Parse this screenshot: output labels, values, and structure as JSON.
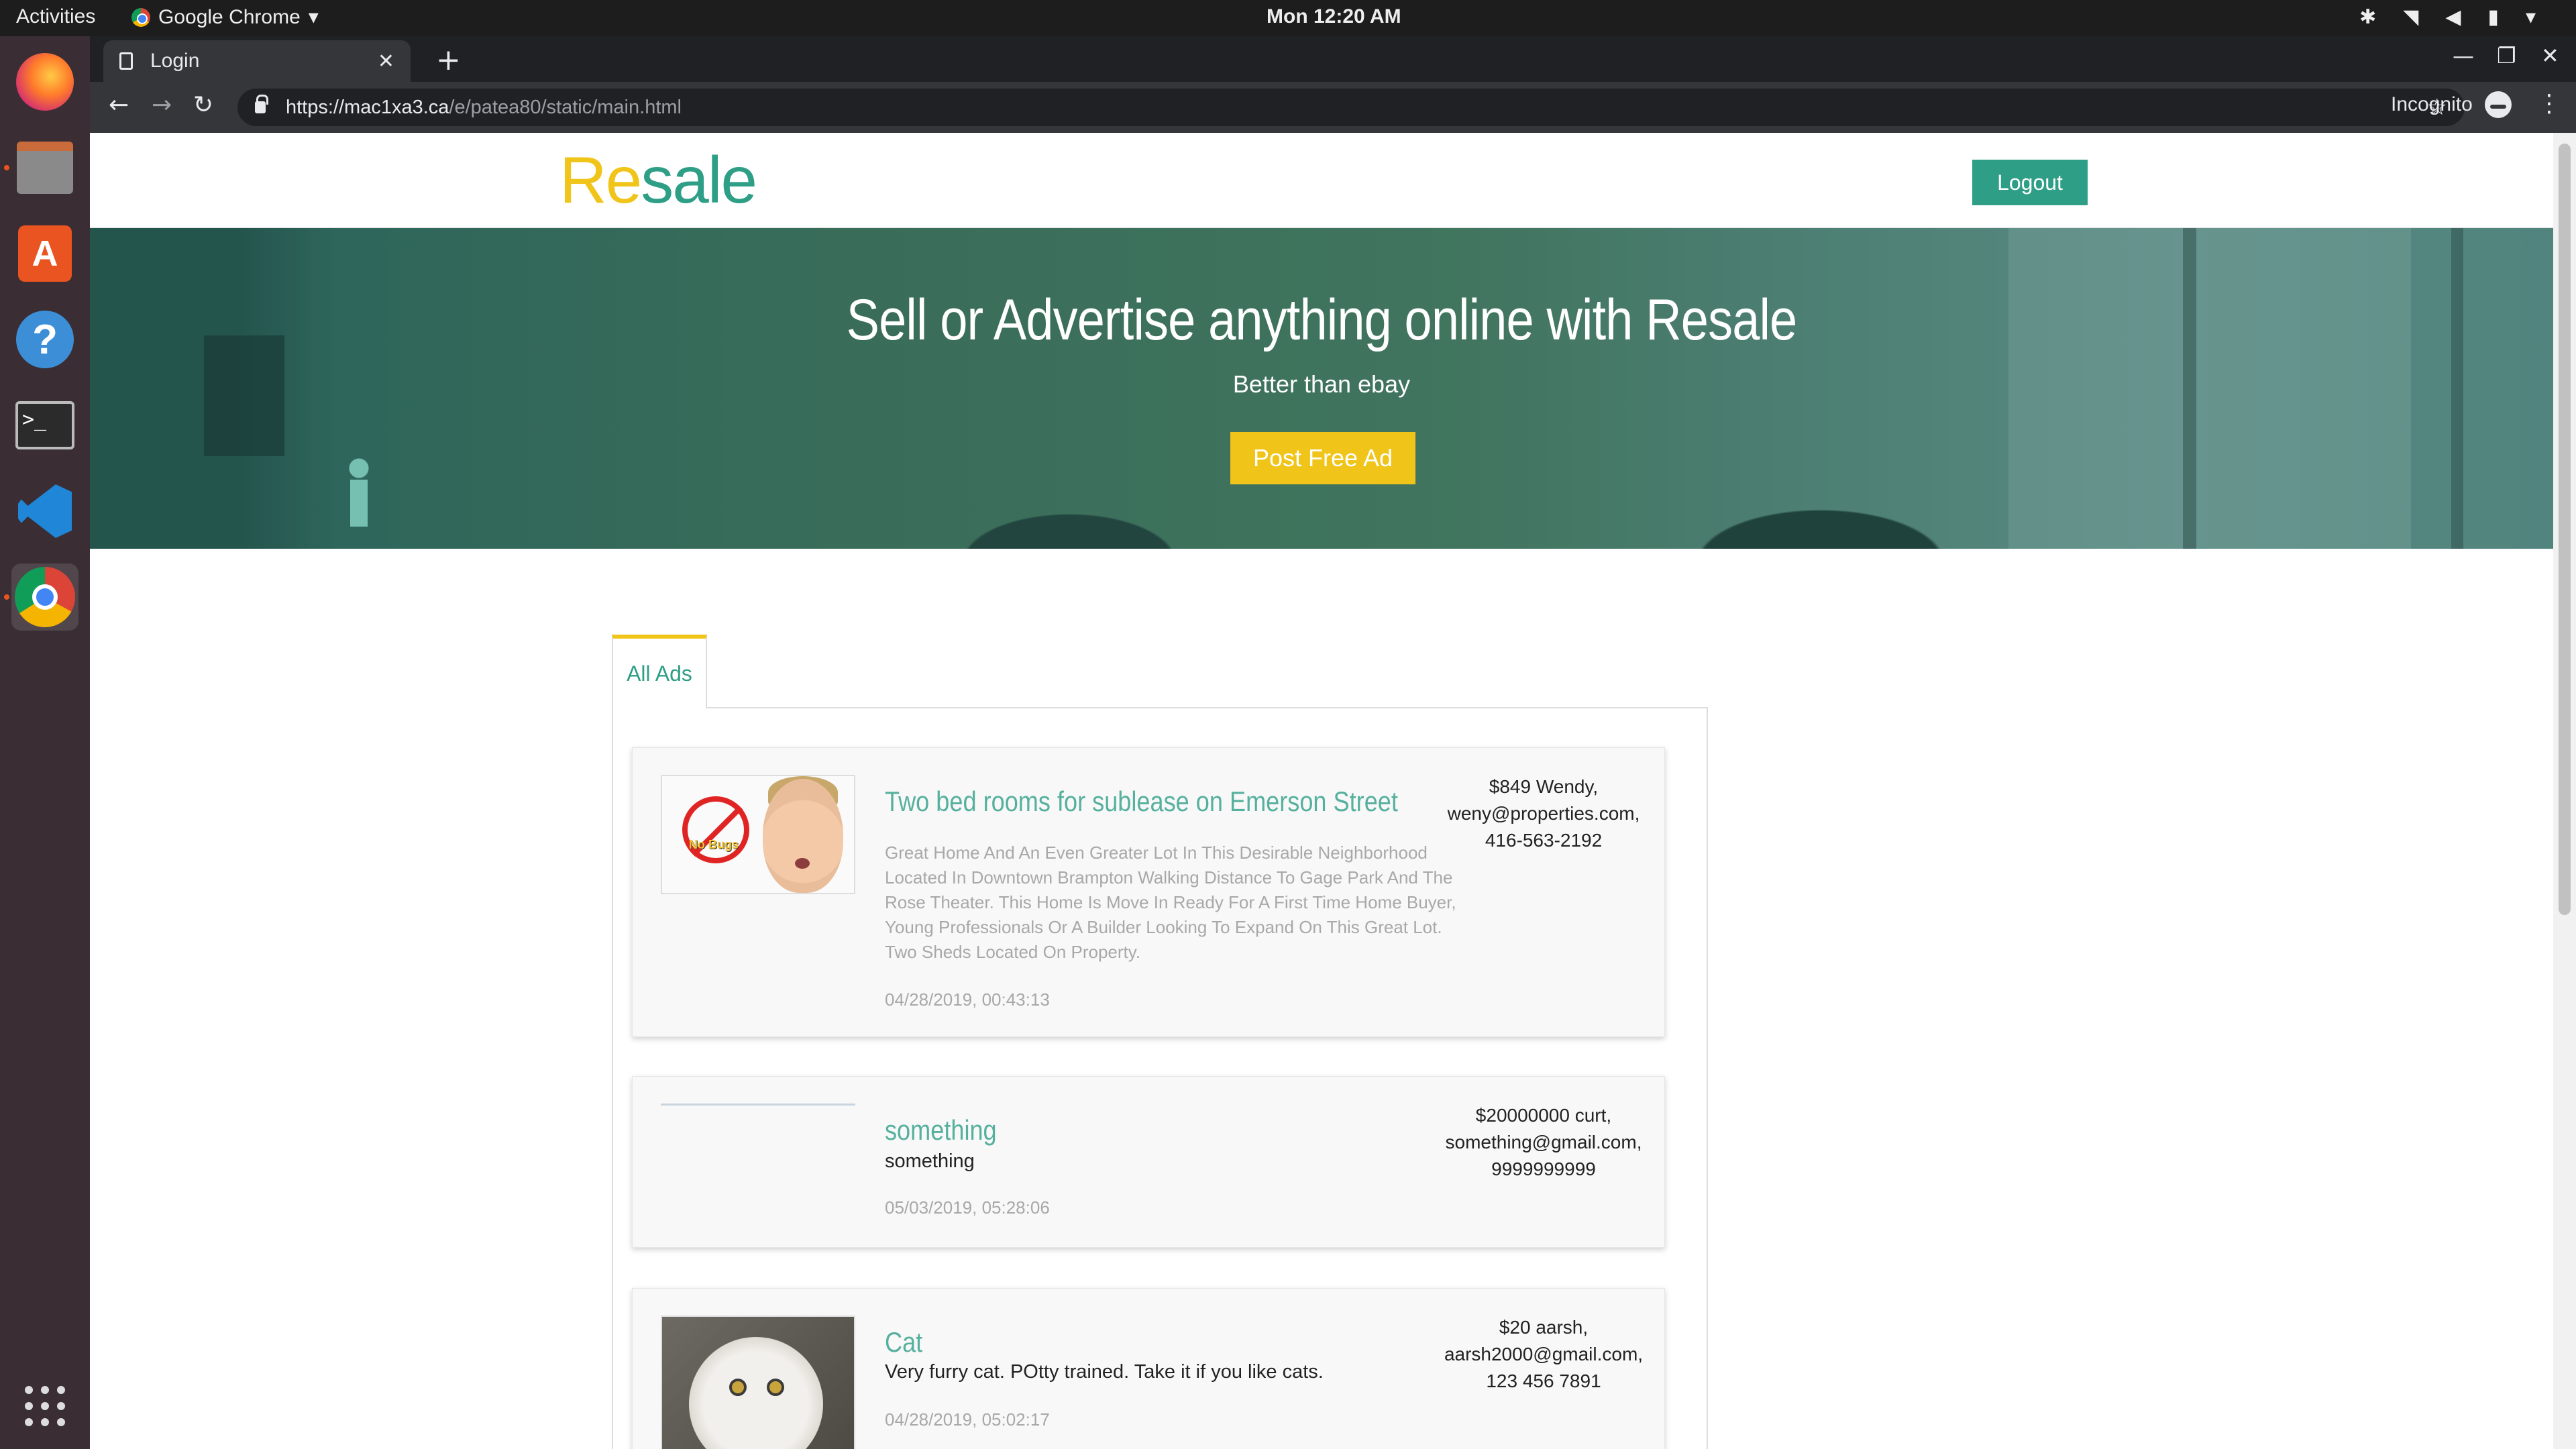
{
  "system": {
    "activities": "Activities",
    "app_name": "Google Chrome",
    "clock": "Mon 12:20 AM"
  },
  "browser": {
    "tab_title": "Login",
    "url_host": "https://mac1xa3.ca",
    "url_path": "/e/patea80/static/main.html",
    "incognito_label": "Incognito"
  },
  "site": {
    "logo_part1": "Re",
    "logo_part2": "sale",
    "logout_label": "Logout",
    "hero_title": "Sell or Advertise anything online with Resale",
    "hero_subtitle": "Better than ebay",
    "post_ad_label": "Post Free Ad",
    "tab_all_ads": "All Ads"
  },
  "ads": [
    {
      "title": "Two bed rooms for sublease on Emerson Street",
      "description": "Great Home And An Even Greater Lot In This Desirable Neighborhood Located In Downtown Brampton Walking Distance To Gage Park And The Rose Theater. This Home Is Move In Ready For A First Time Home Buyer, Young Professionals Or A Builder Looking To Expand On This Great Lot. Two Sheds Located On Property.",
      "date": "04/28/2019, 00:43:13",
      "contact_line1": "$849 Wendy,",
      "contact_line2": "weny@properties.com,",
      "contact_line3": "416-563-2192",
      "image_caption": "No Bugs"
    },
    {
      "title": "something",
      "description": "something",
      "date": "05/03/2019, 05:28:06",
      "contact_line1": "$20000000 curt,",
      "contact_line2": "something@gmail.com,",
      "contact_line3": "9999999999"
    },
    {
      "title": "Cat",
      "description": "Very furry cat. POtty trained. Take it if you like cats.",
      "date": "04/28/2019, 05:02:17",
      "contact_line1": "$20 aarsh,",
      "contact_line2": "aarsh2000@gmail.com,",
      "contact_line3": "123 456 7891"
    }
  ],
  "colors": {
    "brand_yellow": "#f0c419",
    "brand_teal": "#2e9e86"
  }
}
